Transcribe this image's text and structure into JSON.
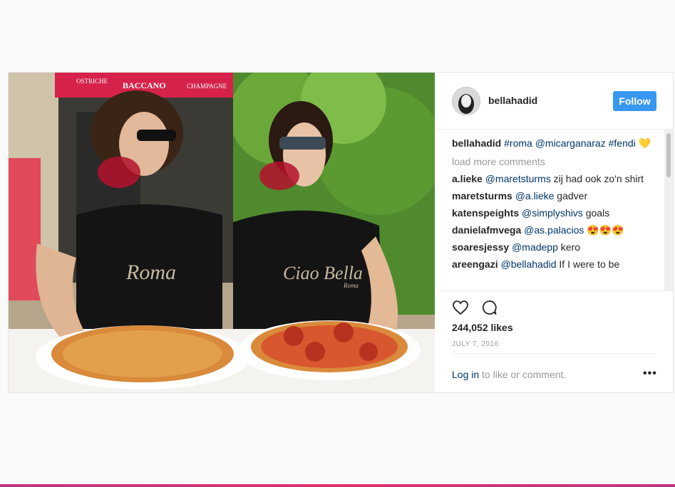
{
  "post": {
    "username": "bellahadid",
    "follow_label": "Follow",
    "caption": {
      "user": "bellahadid",
      "tags": "#roma @micarganaraz #fendi",
      "emoji": "💛"
    },
    "load_more": "load more comments",
    "comments": [
      {
        "user": "a.lieke",
        "mention": "@maretsturms",
        "text": "zij had ook zo'n shirt"
      },
      {
        "user": "maretsturms",
        "mention": "@a.lieke",
        "text": "gadver"
      },
      {
        "user": "katenspeights",
        "mention": "@simplyshivs",
        "text": "goals"
      },
      {
        "user": "danielafmvega",
        "mention": "@as.palacios",
        "text": "😍😍😍"
      },
      {
        "user": "soaresjessy",
        "mention": "@madepp",
        "text": "kero"
      },
      {
        "user": "areengazi",
        "mention": "@bellahadid",
        "text": "If I were to be"
      }
    ],
    "likes": "244,052 likes",
    "date": "JULY 7, 2016",
    "login_link": "Log in",
    "login_text": "to like or comment.",
    "more_label": "•••",
    "photo": {
      "sign_left": "OSTRICHE",
      "sign_center": "BACCANO",
      "sign_right": "CHAMPAGNE",
      "shirt_left": "Roma",
      "shirt_right": "Ciao Bella",
      "shirt_right_sub": "Roma"
    }
  },
  "colors": {
    "follow": "#3897f0",
    "link": "#003569",
    "muted": "#999999",
    "sign": "#d6224a"
  },
  "icons": [
    "heart-icon",
    "comment-icon",
    "more-icon"
  ]
}
